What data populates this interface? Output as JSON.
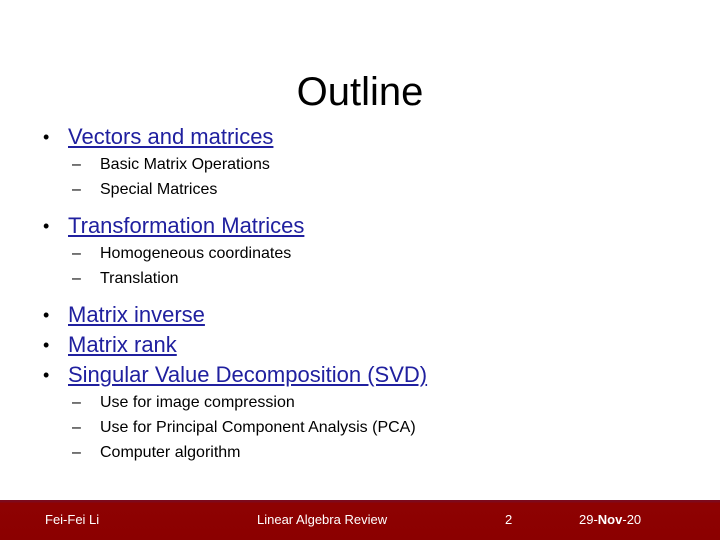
{
  "slide": {
    "title": "Outline",
    "title_color": "#000000",
    "background_color": "#ffffff",
    "link_color": "#20209f",
    "footer_bar_color": "#8b0000",
    "footer_text_color": "#ffffff"
  },
  "outline": {
    "items": [
      {
        "label": "Vectors and matrices",
        "bullet": "•",
        "sub": [
          {
            "bullet": "–",
            "label": "Basic Matrix Operations"
          },
          {
            "bullet": "–",
            "label": "Special Matrices"
          }
        ]
      },
      {
        "label": "Transformation Matrices",
        "bullet": "•",
        "sub": [
          {
            "bullet": "–",
            "label": "Homogeneous coordinates"
          },
          {
            "bullet": "–",
            "label": "Translation"
          }
        ]
      },
      {
        "label": "Matrix inverse",
        "bullet": "•",
        "sub": []
      },
      {
        "label": "Matrix rank",
        "bullet": "•",
        "sub": []
      },
      {
        "label": "Singular Value Decomposition (SVD)",
        "bullet": "•",
        "sub": [
          {
            "bullet": "–",
            "label": "Use for image compression"
          },
          {
            "bullet": "–",
            "label": "Use for Principal Component Analysis (PCA)"
          },
          {
            "bullet": "–",
            "label": "Computer algorithm"
          }
        ]
      }
    ]
  },
  "footer": {
    "author": "Fei-Fei Li",
    "subject": "Linear Algebra Review",
    "page_number": "2",
    "date": "29-Nov-20",
    "date_day": "29-",
    "date_month": "Nov",
    "date_year": "-20"
  }
}
